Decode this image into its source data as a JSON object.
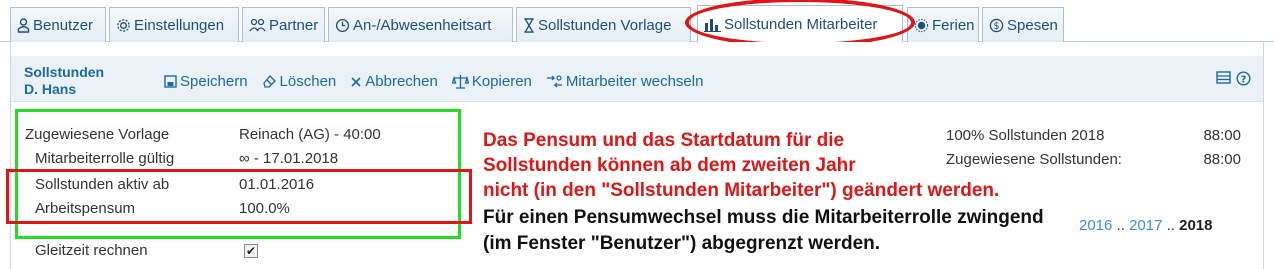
{
  "tabs": [
    {
      "label": "Benutzer",
      "icon": "user-icon"
    },
    {
      "label": "Einstellungen",
      "icon": "gear-icon"
    },
    {
      "label": "Partner",
      "icon": "partner-icon"
    },
    {
      "label": "An-/Abwesenheitsart",
      "icon": "clock-icon"
    },
    {
      "label": "Sollstunden Vorlage",
      "icon": "hourglass-icon"
    },
    {
      "label": "Sollstunden Mitarbeiter",
      "icon": "bar-chart-icon",
      "active": true
    },
    {
      "label": "Ferien",
      "icon": "sun-icon"
    },
    {
      "label": "Spesen",
      "icon": "coin-icon"
    }
  ],
  "panel": {
    "title_line1": "Sollstunden",
    "title_line2": "D. Hans",
    "toolbar": {
      "save": "Speichern",
      "delete": "Löschen",
      "cancel": "Abbrechen",
      "copy": "Kopieren",
      "switch_employee": "Mitarbeiter wechseln"
    }
  },
  "form": {
    "assigned_template_label": "Zugewiesene Vorlage",
    "assigned_template_value": "Reinach (AG) - 40:00",
    "role_valid_label": "Mitarbeiterrolle gültig",
    "role_valid_value": "∞ - 17.01.2018",
    "active_from_label": "Sollstunden aktiv ab",
    "active_from_value": "01.01.2016",
    "workload_label": "Arbeitspensum",
    "workload_value": "100.0%",
    "flextime_label": "Gleitzeit rechnen",
    "flextime_checked": true
  },
  "annotation": {
    "red_line1": "Das Pensum und das Startdatum für die",
    "red_line2": "Sollstunden können ab dem zweiten Jahr",
    "red_line3": "nicht (in den \"Sollstunden Mitarbeiter\") geändert werden.",
    "black_line1": "Für einen Pensumwechsel muss die Mitarbeiterrolle zwingend",
    "black_line2": "(im Fenster \"Benutzer\") abgegrenzt werden."
  },
  "summary": {
    "target_label": "100% Sollstunden 2018",
    "target_value": "88:00",
    "assigned_label": "Zugewiesene Sollstunden:",
    "assigned_value": "88:00"
  },
  "years": {
    "y2016": "2016",
    "sep1": "..",
    "y2017": "2017",
    "sep2": "..",
    "y2018": "2018"
  },
  "colors": {
    "accent": "#1b6aa8",
    "highlight_red": "#e01616",
    "highlight_green": "#22dd22"
  }
}
